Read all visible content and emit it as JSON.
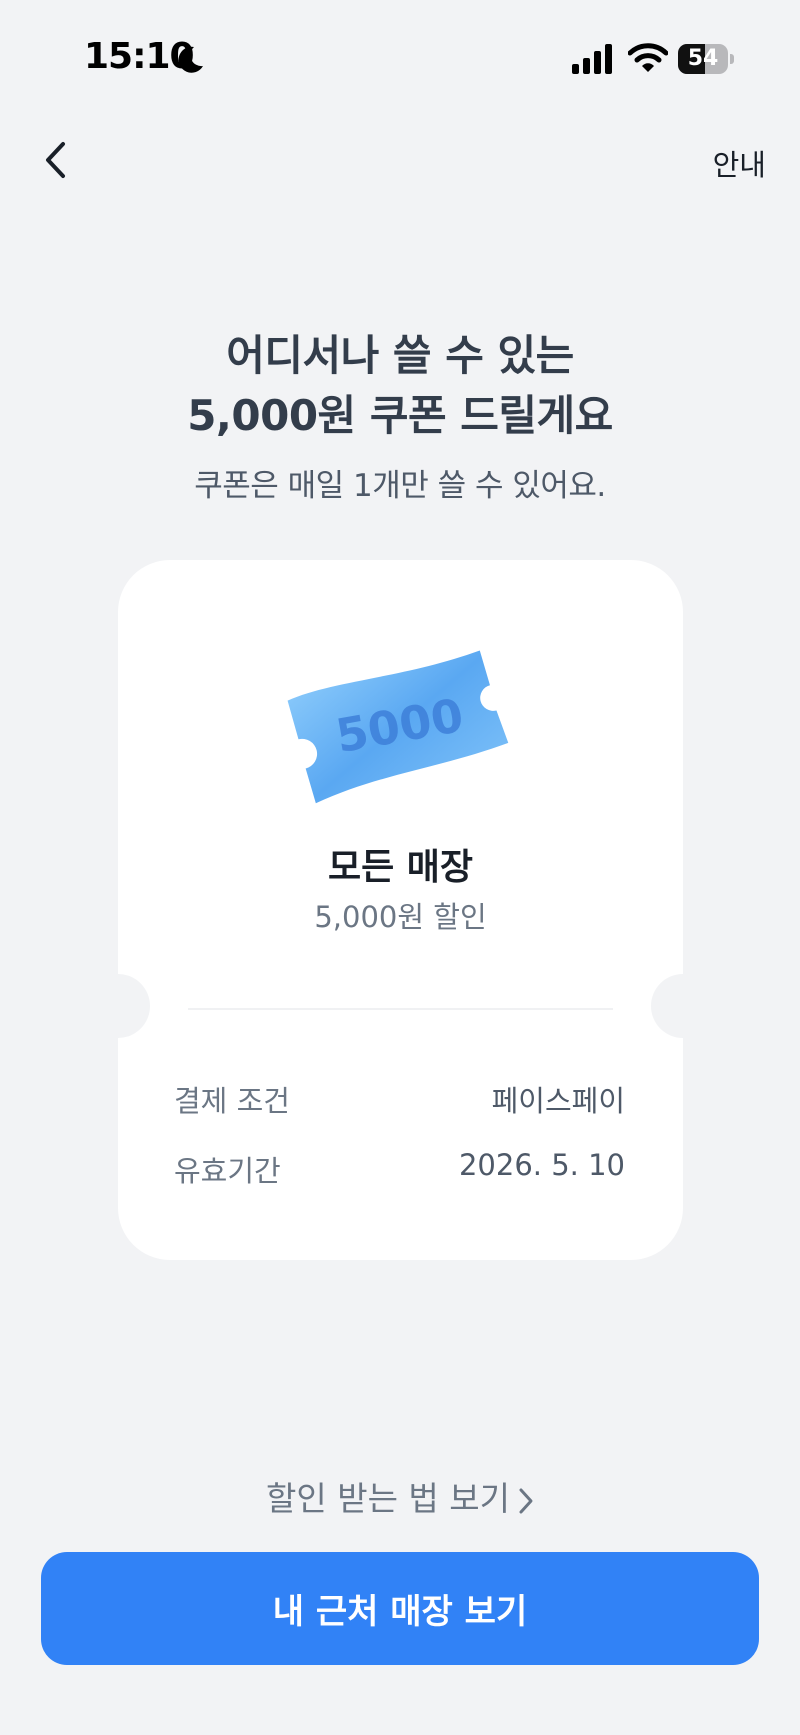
{
  "status_bar": {
    "time": "15:10",
    "battery_level": "54",
    "battery_percent": 54
  },
  "nav": {
    "info_label": "안내"
  },
  "headline": {
    "line1": "어디서나 쓸 수 있는",
    "line2": "5,000원 쿠폰 드릴게요",
    "subtitle": "쿠폰은 매일 1개만 쓸 수 있어요."
  },
  "coupon": {
    "ticket_value": "5000",
    "store": "모든 매장",
    "discount": "5,000원 할인",
    "details": [
      {
        "label": "결제 조건",
        "value": "페이스페이"
      },
      {
        "label": "유효기간",
        "value": "2026. 5. 10"
      }
    ]
  },
  "footer": {
    "howto_link": "할인 받는 법 보기",
    "cta_button": "내 근처 매장 보기"
  },
  "colors": {
    "accent": "#3182f6",
    "background": "#f2f3f5",
    "ticket": "#6ab4f5"
  },
  "icons": [
    "moon-icon",
    "signal-icon",
    "wifi-icon",
    "battery-icon",
    "chevron-left-icon",
    "chevron-right-icon",
    "coupon-ticket-icon"
  ]
}
